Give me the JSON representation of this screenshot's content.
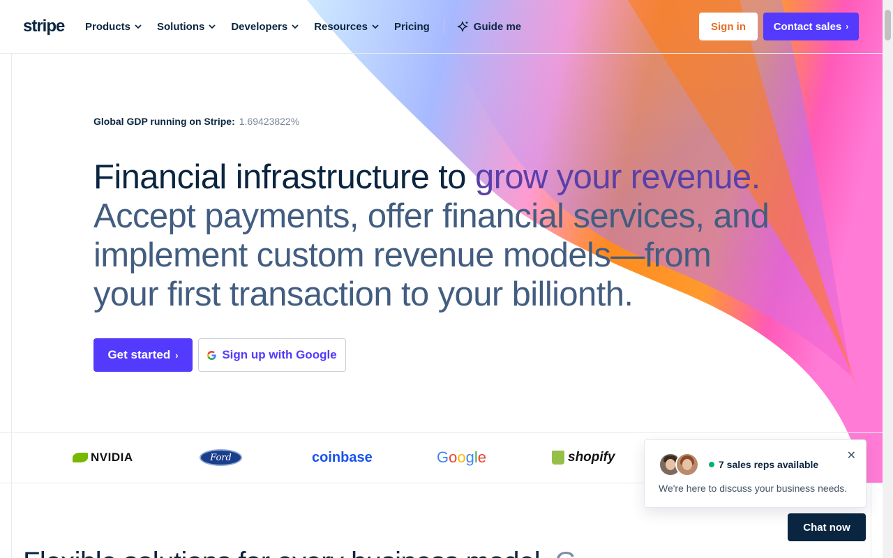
{
  "header": {
    "logo": "stripe",
    "nav": [
      {
        "label": "Products",
        "has_dropdown": true
      },
      {
        "label": "Solutions",
        "has_dropdown": true
      },
      {
        "label": "Developers",
        "has_dropdown": true
      },
      {
        "label": "Resources",
        "has_dropdown": true
      },
      {
        "label": "Pricing",
        "has_dropdown": false
      }
    ],
    "guide_label": "Guide me",
    "signin_label": "Sign in",
    "contact_label": "Contact sales"
  },
  "hero": {
    "gdp_label": "Global GDP running on Stripe:",
    "gdp_value": "1.69423822%",
    "title_dark": "Financial infrastructure to ",
    "title_accent": "grow your revenue.",
    "title_rest": " Accept payments, offer financial services, and implement custom revenue models—from your first transaction to your billionth.",
    "primary_cta": "Get started",
    "google_cta": "Sign up with Google"
  },
  "logos": [
    "NVIDIA",
    "Ford",
    "coinbase",
    "Google",
    "shopify"
  ],
  "next_section": {
    "title_visible": "Flexible solutions for every business model. ",
    "title_accent": "G"
  },
  "chat": {
    "reps_text": "7 sales reps available",
    "message": "We're here to discuss your business needs.",
    "close_icon": "close-icon",
    "chat_now_label": "Chat now"
  },
  "colors": {
    "brand": "#533afd",
    "navy": "#0a2540",
    "signin_text": "#e56f2a",
    "online_dot": "#00b26a"
  }
}
